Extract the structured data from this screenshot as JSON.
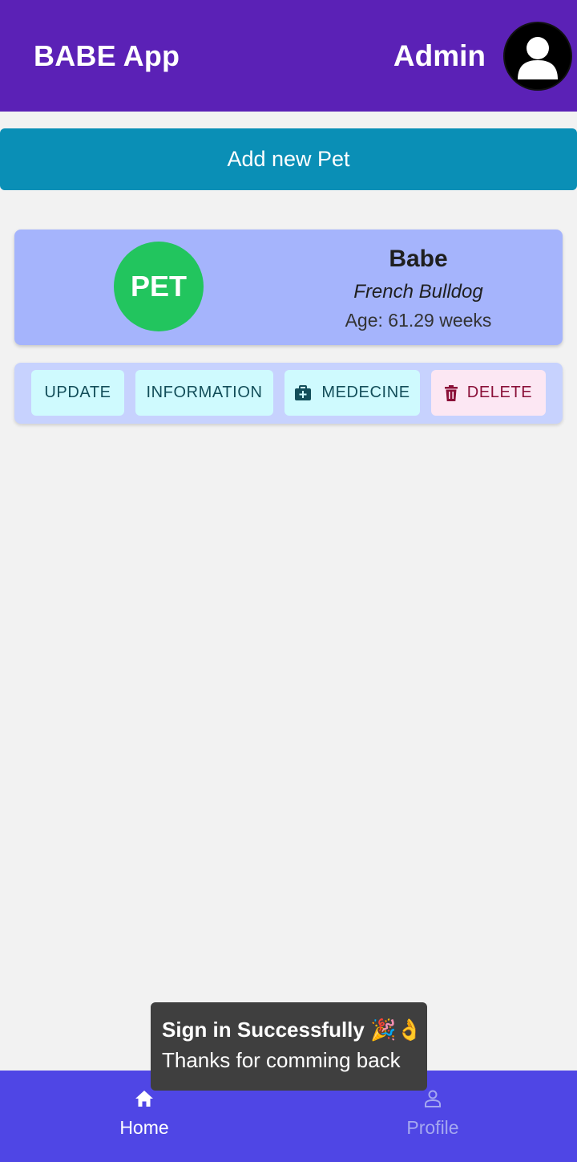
{
  "header": {
    "title": "BABE App",
    "user_label": "Admin",
    "avatar_icon": "user-silhouette-icon"
  },
  "add_pet_button": "Add new Pet",
  "pet": {
    "badge": "PET",
    "name": "Babe",
    "breed": "French Bulldog",
    "age": "Age: 61.29 weeks"
  },
  "actions": {
    "update": "UPDATE",
    "information": "INFORMATION",
    "medecine": "MEDECINE",
    "delete": "DELETE"
  },
  "toast": {
    "title": "Sign in Successfully 🎉👌",
    "message": "Thanks for comming back"
  },
  "bottom_nav": {
    "home": "Home",
    "profile": "Profile"
  },
  "colors": {
    "header_bg": "#5b21b6",
    "add_button_bg": "#0a8fb6",
    "card_bg": "#a5b4fc",
    "actions_bg": "#c7d2fe",
    "pet_badge_bg": "#22c55e",
    "nav_bg": "#4f46e5",
    "toast_bg": "#3f3f3f"
  }
}
